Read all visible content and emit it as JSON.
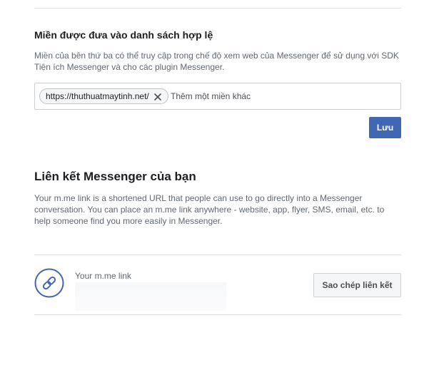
{
  "domains_section": {
    "title": "Miền được đưa vào danh sách hợp lệ",
    "description": "Miền của bên thứ ba có thể truy cập trong chế độ xem web của Messenger để sử dụng với SDK Tiện ích Messenger và cho các plugin Messenger.",
    "chips": [
      {
        "label": "https://thuthuatmaytinh.net/",
        "remove_icon": "close-icon"
      }
    ],
    "input": {
      "value": "",
      "placeholder": "Thêm một miền khác"
    },
    "save_label": "Lưu"
  },
  "link_section": {
    "title": "Liên kết Messenger của bạn",
    "description": "Your m.me link is a shortened URL that people can use to go directly into a Messenger conversation. You can place an m.me link anywhere - website, app, flyer, SMS, email, etc. to help someone find you more easily in Messenger.",
    "link_icon": "link-icon",
    "link_label": "Your m.me link",
    "copy_label": "Sao chép liên kết"
  },
  "colors": {
    "primary": "#4267b2",
    "divider": "#dddfe2",
    "secondary_text": "#606770"
  }
}
